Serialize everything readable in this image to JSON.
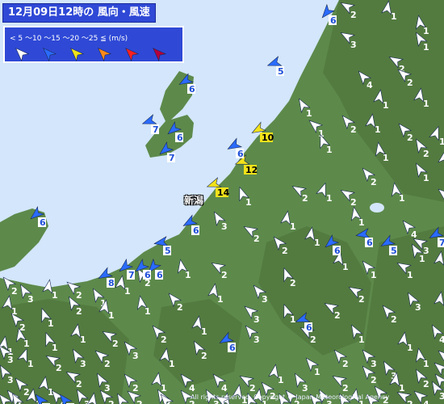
{
  "title": "12月09日12時の 風向・風速",
  "legend": {
    "scale_text": "< 5 ～10 ～15 ～20 ～25 ≦ (m/s)",
    "colors": [
      "#ffffff",
      "#2a6bff",
      "#f2e21a",
      "#ff8a1a",
      "#ff2020",
      "#b4003c"
    ]
  },
  "city_label": "新潟",
  "copyright": "All rights reserved. Copyright © Japan Meteorological Agency",
  "colors": {
    "land": "#5d8a4b",
    "sea": "#d3e6fb",
    "mountain": "#4b7038",
    "legend_bg": "#2f49d6"
  },
  "stations": [
    {
      "dir": 300,
      "speed": "2"
    },
    {
      "dir": 10,
      "speed": "1"
    },
    {
      "dir": 350,
      "speed": "1"
    },
    {
      "dir": 300,
      "speed": "3"
    },
    {
      "dir": 330,
      "speed": "1"
    },
    {
      "dir": 300,
      "speed": "2"
    },
    {
      "dir": 320,
      "speed": "4"
    },
    {
      "dir": 310,
      "speed": "2"
    },
    {
      "dir": 10,
      "speed": "1"
    },
    {
      "dir": 10,
      "speed": "1"
    },
    {
      "dir": 330,
      "speed": "1"
    },
    {
      "dir": 310,
      "speed": "1"
    },
    {
      "dir": 320,
      "speed": "2"
    },
    {
      "dir": 10,
      "speed": "1"
    },
    {
      "dir": 320,
      "speed": "2"
    },
    {
      "dir": 20,
      "speed": "1"
    },
    {
      "dir": 350,
      "speed": "1"
    },
    {
      "dir": 330,
      "speed": "2"
    },
    {
      "dir": 10,
      "speed": "1"
    },
    {
      "dir": 340,
      "speed": "1"
    },
    {
      "dir": 320,
      "speed": "2"
    },
    {
      "dir": 330,
      "speed": "1"
    },
    {
      "dir": 350,
      "speed": "1"
    },
    {
      "dir": 300,
      "speed": "2"
    },
    {
      "dir": 20,
      "speed": "1"
    },
    {
      "dir": 300,
      "speed": "2"
    },
    {
      "dir": 310,
      "speed": "3"
    },
    {
      "dir": 350,
      "speed": "1"
    },
    {
      "dir": 320,
      "speed": "4"
    },
    {
      "dir": 10,
      "speed": "1"
    },
    {
      "dir": 300,
      "speed": "2"
    },
    {
      "dir": 330,
      "speed": "3"
    },
    {
      "dir": 340,
      "speed": "1"
    },
    {
      "dir": 320,
      "speed": "2"
    },
    {
      "dir": 10,
      "speed": "1"
    },
    {
      "dir": 10,
      "speed": "1"
    },
    {
      "dir": 320,
      "speed": "1"
    },
    {
      "dir": 300,
      "speed": "1"
    },
    {
      "dir": 10,
      "speed": "1"
    },
    {
      "dir": 340,
      "speed": "2"
    },
    {
      "dir": 320,
      "speed": "3"
    },
    {
      "dir": 300,
      "speed": "2"
    },
    {
      "dir": 350,
      "speed": "1"
    },
    {
      "dir": 330,
      "speed": "2"
    },
    {
      "dir": 10,
      "speed": "1"
    },
    {
      "dir": 330,
      "speed": "1"
    },
    {
      "dir": 310,
      "speed": "2"
    },
    {
      "dir": 10,
      "speed": "1"
    },
    {
      "dir": 330,
      "speed": "3"
    },
    {
      "dir": 320,
      "speed": "2"
    },
    {
      "dir": 300,
      "speed": "2"
    },
    {
      "dir": 330,
      "speed": "3"
    },
    {
      "dir": 320,
      "speed": "2"
    },
    {
      "dir": 10,
      "speed": "1"
    },
    {
      "dir": 300,
      "speed": "2"
    },
    {
      "dir": 340,
      "speed": "1"
    },
    {
      "dir": 310,
      "speed": "3"
    },
    {
      "dir": 10,
      "speed": "1"
    },
    {
      "dir": 320,
      "speed": "2"
    },
    {
      "dir": 350,
      "speed": "1"
    },
    {
      "dir": 10,
      "speed": "1"
    },
    {
      "dir": 330,
      "speed": "2"
    },
    {
      "dir": 340,
      "speed": "1"
    },
    {
      "dir": 320,
      "speed": "2"
    },
    {
      "dir": 10,
      "speed": "1"
    },
    {
      "dir": 300,
      "speed": "2"
    },
    {
      "dir": 330,
      "speed": "1"
    },
    {
      "dir": 320,
      "speed": "2"
    },
    {
      "dir": 10,
      "speed": "1"
    },
    {
      "dir": 330,
      "speed": "4"
    },
    {
      "dir": 320,
      "speed": "3"
    },
    {
      "dir": 10,
      "speed": "1"
    },
    {
      "dir": 320,
      "speed": "2"
    },
    {
      "dir": 300,
      "speed": "2"
    },
    {
      "dir": 10,
      "speed": "1"
    },
    {
      "dir": 340,
      "speed": "1"
    },
    {
      "dir": 350,
      "speed": "1"
    },
    {
      "dir": 10,
      "speed": "1"
    },
    {
      "dir": 320,
      "speed": "3"
    },
    {
      "dir": 330,
      "speed": "3"
    },
    {
      "dir": 350,
      "speed": "1"
    },
    {
      "dir": 310,
      "speed": "2"
    },
    {
      "dir": 320,
      "speed": "1"
    },
    {
      "dir": 10,
      "speed": "1"
    },
    {
      "dir": 300,
      "speed": "2"
    },
    {
      "dir": 320,
      "speed": "4"
    },
    {
      "dir": 330,
      "speed": "2"
    },
    {
      "dir": 10,
      "speed": "1"
    },
    {
      "dir": 320,
      "speed": "3"
    },
    {
      "dir": 310,
      "speed": "2"
    },
    {
      "dir": 330,
      "speed": "3"
    },
    {
      "dir": 300,
      "speed": "2"
    },
    {
      "dir": 20,
      "speed": "1"
    },
    {
      "dir": 320,
      "speed": "3"
    },
    {
      "dir": 330,
      "speed": "2"
    },
    {
      "dir": 10,
      "speed": "1"
    },
    {
      "dir": 320,
      "speed": "2"
    },
    {
      "dir": 300,
      "speed": "2"
    },
    {
      "dir": 330,
      "speed": "3"
    },
    {
      "dir": 320,
      "speed": "2"
    },
    {
      "dir": 10,
      "speed": "1"
    },
    {
      "dir": 330,
      "speed": "3"
    },
    {
      "dir": 320,
      "speed": "4"
    },
    {
      "dir": 10,
      "speed": "1"
    },
    {
      "dir": 320,
      "speed": "2"
    },
    {
      "dir": 330,
      "speed": "3"
    },
    {
      "dir": 300,
      "speed": "2"
    },
    {
      "dir": 10,
      "speed": "1"
    },
    {
      "dir": 320,
      "speed": "2"
    },
    {
      "dir": 330,
      "speed": "3"
    },
    {
      "dir": 310,
      "speed": "4"
    },
    {
      "dir": 320,
      "speed": "2"
    },
    {
      "dir": 10,
      "speed": "1"
    },
    {
      "dir": 330,
      "speed": "3"
    },
    {
      "dir": 320,
      "speed": "2"
    },
    {
      "dir": 10,
      "speed": "1"
    },
    {
      "dir": 10,
      "speed": "1"
    },
    {
      "dir": 320,
      "speed": "2"
    },
    {
      "dir": 330,
      "speed": "3"
    },
    {
      "dir": 310,
      "speed": "2"
    },
    {
      "dir": 320,
      "speed": "2"
    },
    {
      "dir": 330,
      "speed": "3"
    },
    {
      "dir": 320,
      "speed": "4"
    },
    {
      "dir": 10,
      "speed": "1"
    },
    {
      "dir": 320,
      "speed": "2"
    },
    {
      "dir": 330,
      "speed": "3"
    },
    {
      "dir": 300,
      "speed": "2"
    },
    {
      "dir": 320,
      "speed": "4"
    },
    {
      "dir": 330,
      "speed": "3"
    },
    {
      "dir": 320,
      "speed": "2"
    },
    {
      "dir": 330,
      "speed": "3"
    },
    {
      "dir": 340,
      "speed": "4"
    },
    {
      "dir": 300,
      "speed": "4"
    },
    {
      "dir": 320,
      "speed": "2"
    },
    {
      "dir": 330,
      "speed": "3"
    },
    {
      "dir": 10,
      "speed": "1"
    },
    {
      "dir": 320,
      "speed": "5"
    },
    {
      "dir": 320,
      "speed": "5"
    },
    {
      "dir": 330,
      "speed": "3"
    },
    {
      "dir": 320,
      "speed": "2"
    },
    {
      "dir": 310,
      "speed": "2"
    },
    {
      "dir": 320,
      "speed": "2"
    },
    {
      "dir": 300,
      "speed": "3"
    },
    {
      "dir": 330,
      "speed": "1"
    },
    {
      "dir": 240,
      "speed": "5"
    },
    {
      "dir": 260,
      "speed": "6"
    },
    {
      "dir": 240,
      "speed": "7"
    },
    {
      "dir": 230,
      "speed": "6"
    },
    {
      "dir": 220,
      "speed": "6"
    },
    {
      "dir": 250,
      "speed": "5"
    },
    {
      "dir": 240,
      "speed": "6"
    },
    {
      "dir": 230,
      "speed": "6"
    },
    {
      "dir": 250,
      "speed": "12"
    },
    {
      "dir": 250,
      "speed": "14"
    },
    {
      "dir": 240,
      "speed": "10"
    },
    {
      "dir": 250,
      "speed": "7"
    },
    {
      "dir": 240,
      "speed": "6"
    },
    {
      "dir": 230,
      "speed": "7"
    },
    {
      "dir": 240,
      "speed": "6"
    },
    {
      "dir": 260,
      "speed": "5"
    },
    {
      "dir": 230,
      "speed": "7"
    },
    {
      "dir": 240,
      "speed": "8"
    },
    {
      "dir": 220,
      "speed": "6"
    },
    {
      "dir": 230,
      "speed": "6"
    },
    {
      "dir": 240,
      "speed": "6"
    },
    {
      "dir": 250,
      "speed": "6"
    },
    {
      "dir": 230,
      "speed": "6"
    }
  ]
}
